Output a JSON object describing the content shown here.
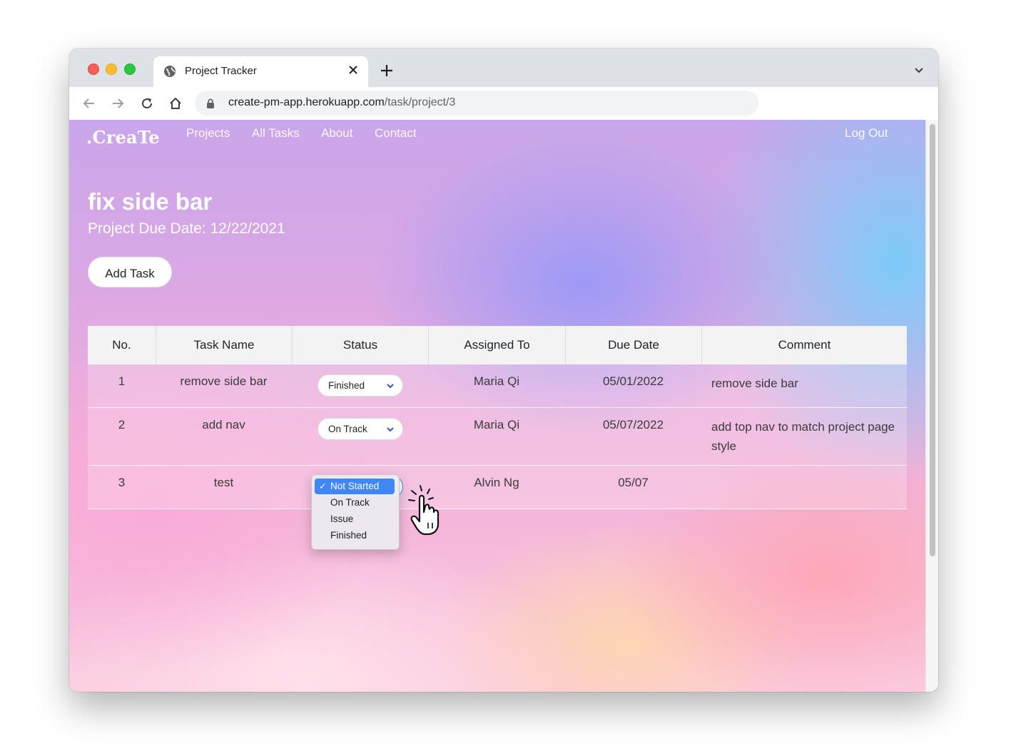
{
  "browser": {
    "tab_title": "Project Tracker",
    "url_host": "create-pm-app.herokuapp.com",
    "url_path": "/task/project/3"
  },
  "site": {
    "logo": ".CreaTe",
    "nav": [
      "Projects",
      "All Tasks",
      "About",
      "Contact"
    ],
    "logout": "Log Out"
  },
  "project": {
    "title": "fix side bar",
    "due_date": "Project Due Date: 12/22/2021",
    "add_task_label": "Add Task"
  },
  "table": {
    "headers": [
      "No.",
      "Task Name",
      "Status",
      "Assigned To",
      "Due Date",
      "Comment"
    ],
    "rows": [
      {
        "no": "1",
        "task": "remove side bar",
        "status": "Finished",
        "assigned": "Maria Qi",
        "due": "05/01/2022",
        "comment": "remove side bar"
      },
      {
        "no": "2",
        "task": "add nav",
        "status": "On Track",
        "assigned": "Maria Qi",
        "due": "05/07/2022",
        "comment": "add top nav to match project page style"
      },
      {
        "no": "3",
        "task": "test",
        "status": "Not Started",
        "assigned": "Alvin Ng",
        "due": "05/07",
        "comment": ""
      }
    ]
  },
  "status_dropdown": {
    "options": [
      "Not Started",
      "On Track",
      "Issue",
      "Finished"
    ],
    "selected": "Not Started",
    "check": "✓"
  },
  "colors": {
    "selected_option": "#3f87f5",
    "chevron": "#3b4fd1"
  }
}
